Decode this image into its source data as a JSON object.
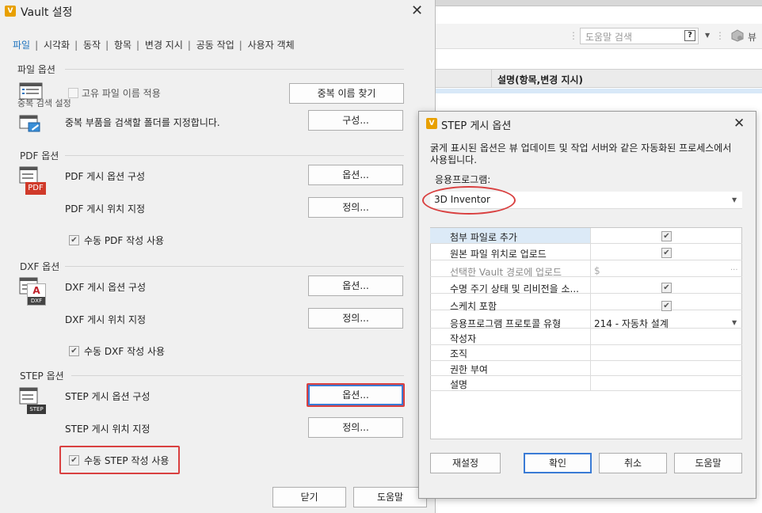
{
  "background_app": {
    "search_placeholder": "도움말 검색",
    "help_q": "?",
    "column_title": "설명(항목,변경 지시)",
    "extra_label": "뷰"
  },
  "vault_dialog": {
    "logo": "V",
    "title": "Vault 설정",
    "close": "✕",
    "tabs": [
      "파일",
      "시각화",
      "동작",
      "항목",
      "변경 지시",
      "공동 작업",
      "사용자 객체"
    ],
    "file_options": {
      "title": "파일 옵션",
      "unique_name_label": "고유 파일 이름 적용",
      "find_duplicates_button": "중복 이름 찾기",
      "duplicate_search_title": "중복 검색 설정",
      "duplicate_search_desc": "중복 부품을 검색할 폴더를 지정합니다.",
      "configure_button": "구성..."
    },
    "pdf_options": {
      "title": "PDF 옵션",
      "publish_options_label": "PDF 게시 옵션 구성",
      "options_button": "옵션...",
      "publish_location_label": "PDF 게시 위치 지정",
      "define_button": "정의...",
      "manual_label": "수동 PDF 작성 사용"
    },
    "dxf_options": {
      "title": "DXF 옵션",
      "publish_options_label": "DXF 게시 옵션 구성",
      "options_button": "옵션...",
      "publish_location_label": "DXF 게시 위치 지정",
      "define_button": "정의...",
      "manual_label": "수동 DXF 작성 사용"
    },
    "step_options": {
      "title": "STEP 옵션",
      "publish_options_label": "STEP 게시 옵션 구성",
      "options_button": "옵션...",
      "publish_location_label": "STEP 게시 위치 지정",
      "define_button": "정의...",
      "manual_label": "수동 STEP 작성 사용"
    },
    "icon_labels": {
      "pdf": "PDF",
      "dxf_letter": "A",
      "dxf": "DXF",
      "step": "STEP"
    },
    "close_button": "닫기",
    "help_button": "도움말"
  },
  "step_dialog": {
    "logo": "V",
    "title": "STEP 게시 옵션",
    "close": "✕",
    "description": "굵게 표시된 옵션은 뷰 업데이트 및 작업 서버와 같은 자동화된 프로세스에서 사용됩니다.",
    "app_label": "응용프로그램:",
    "app_value": "3D Inventor",
    "rows": [
      {
        "label": "첨부 파일로 추가",
        "value": "",
        "checked": true
      },
      {
        "label": "원본 파일 위치로 업로드",
        "value": "",
        "checked": true
      },
      {
        "label": "선택한 Vault 경로에 업로드",
        "value": "$",
        "checked": false
      },
      {
        "label": "수명 주기 상태 및 리비전을 소...",
        "value": "",
        "checked": true
      },
      {
        "label": "스케치 포함",
        "value": "",
        "checked": true
      },
      {
        "label": "응용프로그램 프로토콜 유형",
        "value": "214 - 자동차 설계",
        "checked": false
      },
      {
        "label": "작성자",
        "value": "",
        "checked": false
      },
      {
        "label": "조직",
        "value": "",
        "checked": false
      },
      {
        "label": "권한 부여",
        "value": "",
        "checked": false
      },
      {
        "label": "설명",
        "value": "",
        "checked": false
      }
    ],
    "path_ellipsis": "...",
    "reset_button": "재설정",
    "ok_button": "확인",
    "cancel_button": "취소",
    "help_button": "도움말"
  }
}
